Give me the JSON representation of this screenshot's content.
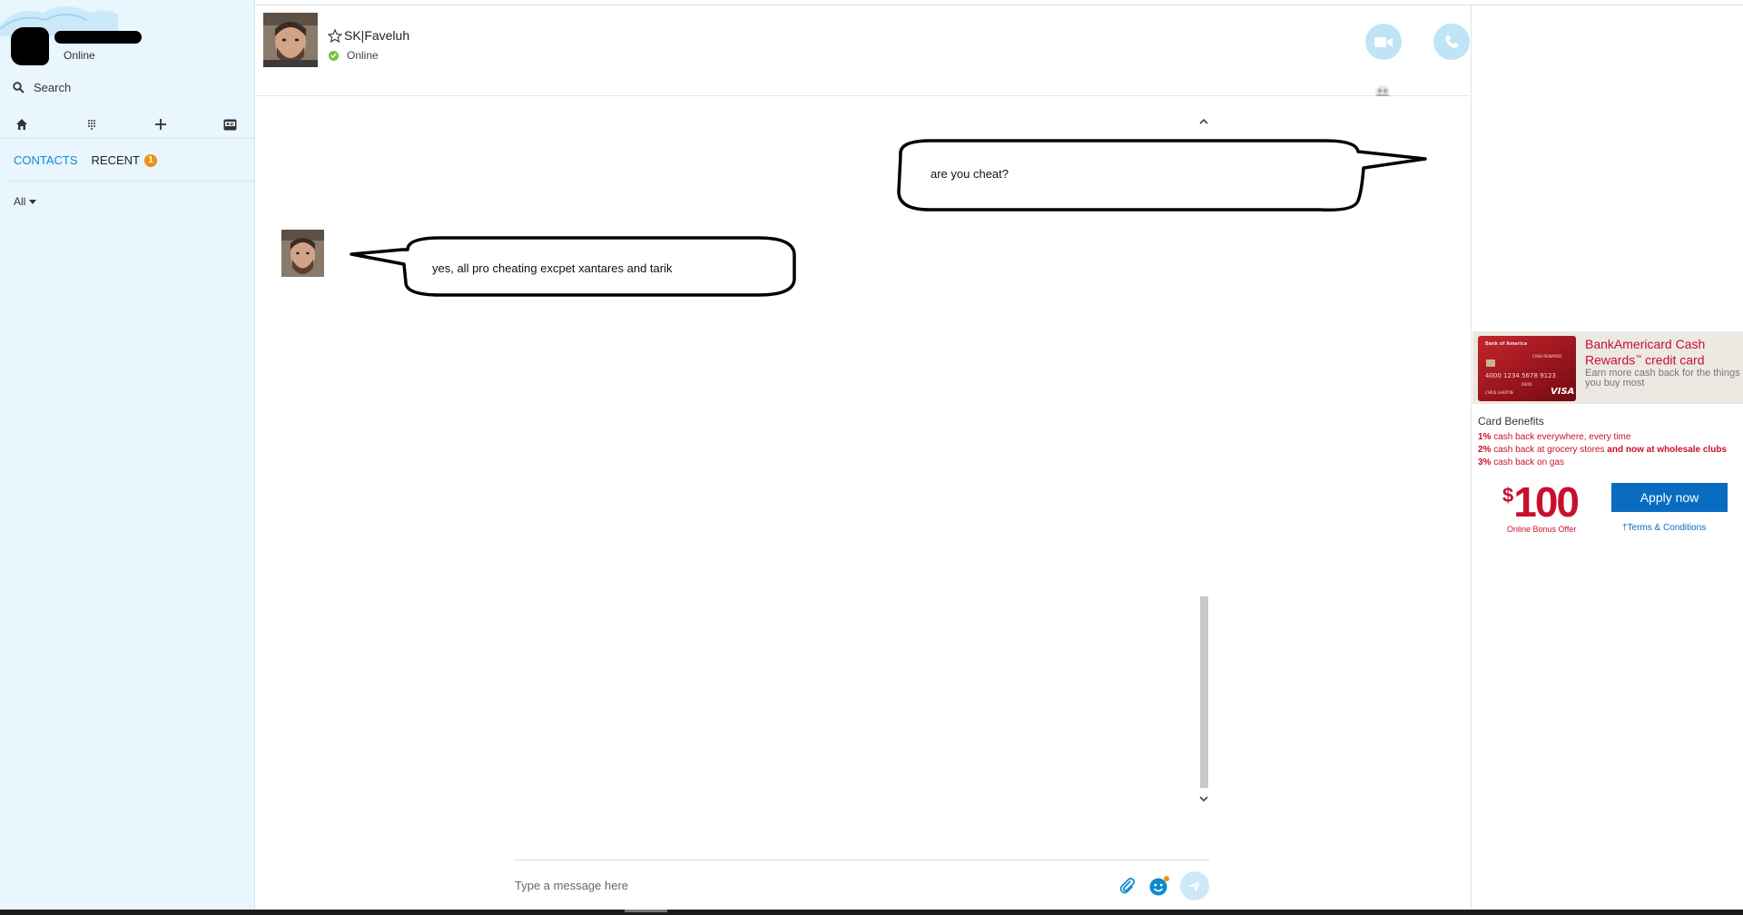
{
  "sidebar": {
    "profile": {
      "status": "Online"
    },
    "search": {
      "label": "Search"
    },
    "nav": {
      "home_icon": "home-icon",
      "dialpad_icon": "dialpad-icon",
      "add_icon": "plus-icon",
      "contact_card_icon": "contact-card-icon"
    },
    "tabs": [
      {
        "label": "CONTACTS",
        "active": true
      },
      {
        "label": "RECENT",
        "badge": "1"
      }
    ],
    "filter": {
      "label": "All"
    }
  },
  "chat": {
    "contact": {
      "name": "SK|Faveluh",
      "status": "Online",
      "favorite_icon": "star-outline-icon"
    },
    "actions": {
      "video_icon": "video-camera-icon",
      "call_icon": "phone-icon",
      "participants_icon": "participants-icon"
    },
    "messages": [
      {
        "direction": "outgoing",
        "text": "are you cheat?"
      },
      {
        "direction": "incoming",
        "text": "yes, all pro cheating excpet xantares and tarik"
      }
    ],
    "composer": {
      "placeholder": "Type a message here",
      "attach_icon": "paperclip-icon",
      "emoji_icon": "emoticon-icon",
      "send_icon": "send-icon"
    }
  },
  "ad": {
    "card_image": {
      "bank": "Bank of America",
      "program": "CASH REWARDS",
      "number": "4000 1234 5678 9123",
      "holder": "CHRIS LHARTIN",
      "expiry": "00/00",
      "network": "VISA"
    },
    "title_line1": "BankAmericard Cash",
    "title_line2": "Rewards",
    "title_tm": "™",
    "title_line2_rest": " credit card",
    "subtitle": "Earn more cash back for the things you buy most",
    "benefits_title": "Card Benefits",
    "benefits": [
      {
        "pct": "1%",
        "text": " cash back everywhere, every time",
        "bold": ""
      },
      {
        "pct": "2%",
        "text": " cash back at grocery stores ",
        "bold": "and now at wholesale clubs"
      },
      {
        "pct": "3%",
        "text": " cash back on gas",
        "bold": ""
      }
    ],
    "bonus_currency": "$",
    "bonus_amount": "100",
    "bonus_label": "Online Bonus Offer",
    "apply_label": "Apply now",
    "terms_label": "†Terms & Conditions",
    "colors": {
      "brand_red": "#c8102e",
      "apply_blue": "#0a6cc1"
    }
  },
  "colors": {
    "skype_blue": "#0d8bd0",
    "sidebar_bg": "#e9f6fd",
    "online_green": "#7ac143",
    "badge_orange": "#f29111"
  }
}
